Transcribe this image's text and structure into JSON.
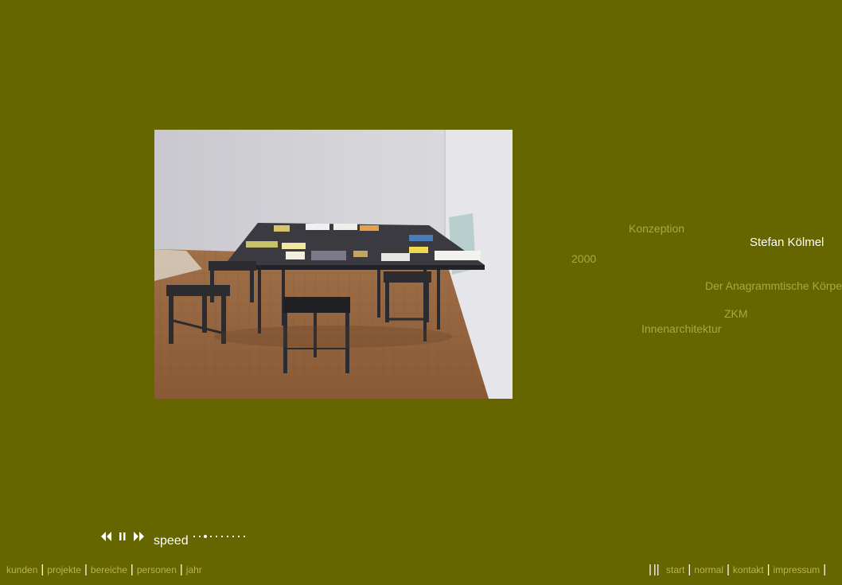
{
  "photo": {
    "alt": "Der Anagrammtische Körper – ZKM"
  },
  "tags": {
    "category": "Konzeption",
    "person": "Stefan Kölmel",
    "year": "2000",
    "project": "Der Anagrammtische Körper",
    "client": "ZKM",
    "area": "Innenarchitektur"
  },
  "player": {
    "rewind_icon": "rewind-icon",
    "pause_icon": "pause-icon",
    "forward_icon": "fast-forward-icon",
    "speed_label": "speed",
    "speed_steps": 10,
    "speed_selected": 3
  },
  "nav_left": [
    "kunden",
    "projekte",
    "bereiche",
    "personen",
    "jahr"
  ],
  "nav_right": [
    "start",
    "normal",
    "kontakt",
    "impressum"
  ],
  "colors": {
    "background": "#666600",
    "tag_text": "#a9a83c",
    "active_text": "#ffffff",
    "nav_link": "#b8b44a"
  }
}
